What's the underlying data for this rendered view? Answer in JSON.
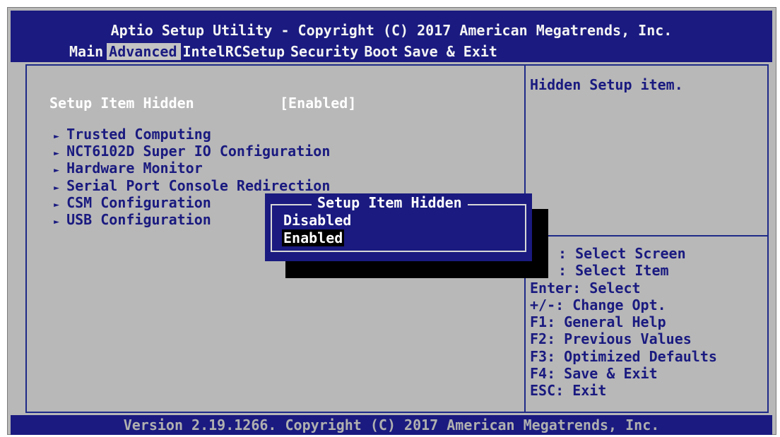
{
  "app_title": "Aptio Setup Utility - Copyright (C) 2017 American Megatrends, Inc.",
  "tabs": [
    {
      "label": "Main"
    },
    {
      "label": "Advanced",
      "active": true
    },
    {
      "label": "IntelRCSetup"
    },
    {
      "label": "Security"
    },
    {
      "label": "Boot"
    },
    {
      "label": "Save & Exit"
    }
  ],
  "setting": {
    "label": "Setup Item Hidden",
    "value": "[Enabled]"
  },
  "menu_items": [
    {
      "label": "Trusted Computing"
    },
    {
      "label": "NCT6102D Super IO Configuration"
    },
    {
      "label": "Hardware Monitor"
    },
    {
      "label": "Serial Port Console Redirection"
    },
    {
      "label": "CSM Configuration"
    },
    {
      "label": "USB Configuration"
    }
  ],
  "help_text": "Hidden Setup item.",
  "key_help": [
    ": Select Screen",
    ": Select Item",
    "Enter: Select",
    "+/-: Change Opt.",
    "F1: General Help",
    "F2: Previous Values",
    "F3: Optimized Defaults",
    "F4: Save & Exit",
    "ESC: Exit"
  ],
  "popup": {
    "title": "Setup Item Hidden",
    "options": [
      {
        "label": "Disabled",
        "selected": false
      },
      {
        "label": "Enabled",
        "selected": true
      }
    ]
  },
  "footer": "Version 2.19.1266. Copyright (C) 2017 American Megatrends, Inc.",
  "colors": {
    "bios_blue": "#1a1a80",
    "background_gray": "#b8b8b8",
    "highlight_black": "#000000"
  }
}
